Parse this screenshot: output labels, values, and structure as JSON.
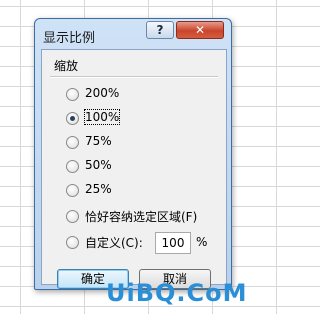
{
  "dialog": {
    "title": "显示比例",
    "help_label": "?",
    "close_label": "✕"
  },
  "zoom_group": {
    "label": "缩放",
    "options": [
      {
        "label": "200%",
        "selected": false
      },
      {
        "label": "100%",
        "selected": true
      },
      {
        "label": "75%",
        "selected": false
      },
      {
        "label": "50%",
        "selected": false
      },
      {
        "label": "25%",
        "selected": false
      },
      {
        "label": "恰好容纳选定区域(F)",
        "selected": false
      },
      {
        "label": "自定义(C):",
        "selected": false
      }
    ],
    "custom_value": "100",
    "custom_unit": "%"
  },
  "buttons": {
    "ok_label": "确定",
    "cancel_label": "取消"
  },
  "watermark": "UiBQ.CoM"
}
